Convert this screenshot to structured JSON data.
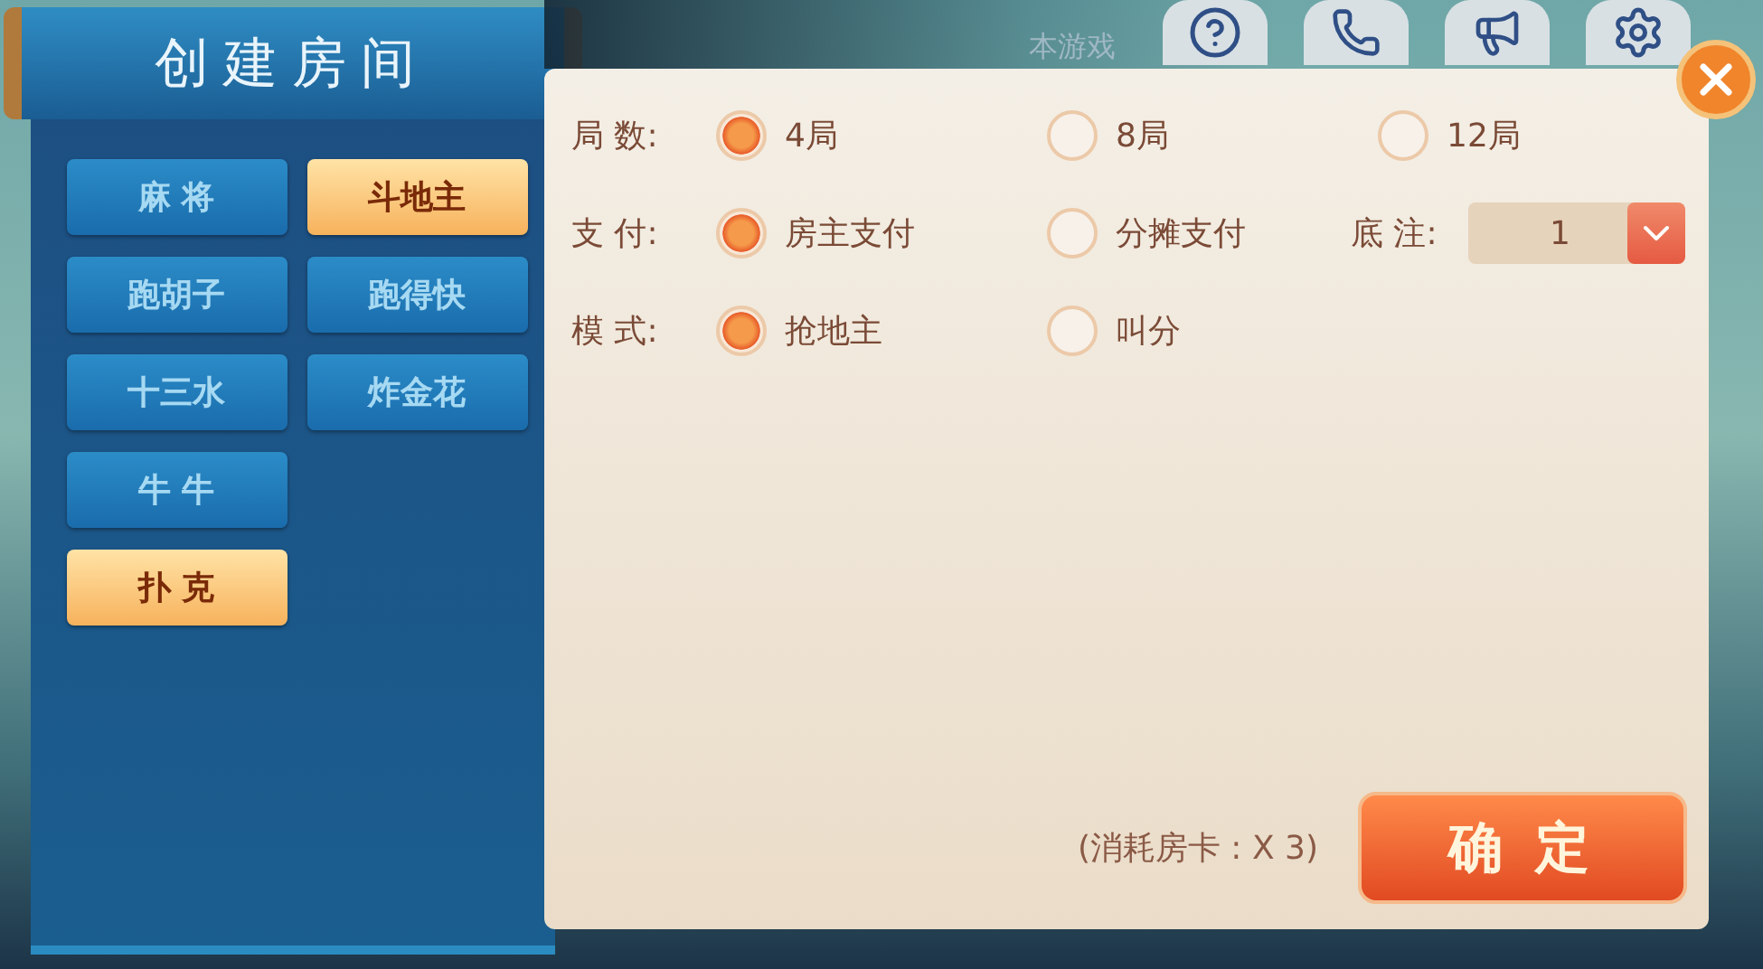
{
  "title": "创建房间",
  "games": [
    {
      "label": "麻 将",
      "selected": false
    },
    {
      "label": "斗地主",
      "selected": true
    },
    {
      "label": "跑胡子",
      "selected": false
    },
    {
      "label": "跑得快",
      "selected": false
    },
    {
      "label": "十三水",
      "selected": false
    },
    {
      "label": "炸金花",
      "selected": false
    },
    {
      "label": "牛 牛",
      "selected": false
    },
    {
      "label": "扑 克",
      "selected": true
    }
  ],
  "notice": "本游戏",
  "options": [
    {
      "label": "局 数:",
      "choices": [
        {
          "label": "4局",
          "selected": true
        },
        {
          "label": "8局",
          "selected": false
        },
        {
          "label": "12局",
          "selected": false
        }
      ]
    },
    {
      "label": "支 付:",
      "choices": [
        {
          "label": "房主支付",
          "selected": true
        },
        {
          "label": "分摊支付",
          "selected": false
        }
      ],
      "bet": {
        "label": "底 注:",
        "value": "1"
      }
    },
    {
      "label": "模 式:",
      "choices": [
        {
          "label": "抢地主",
          "selected": true
        },
        {
          "label": "叫分",
          "selected": false
        }
      ]
    }
  ],
  "cost": "(消耗房卡 : X 3)",
  "confirm": "确 定"
}
